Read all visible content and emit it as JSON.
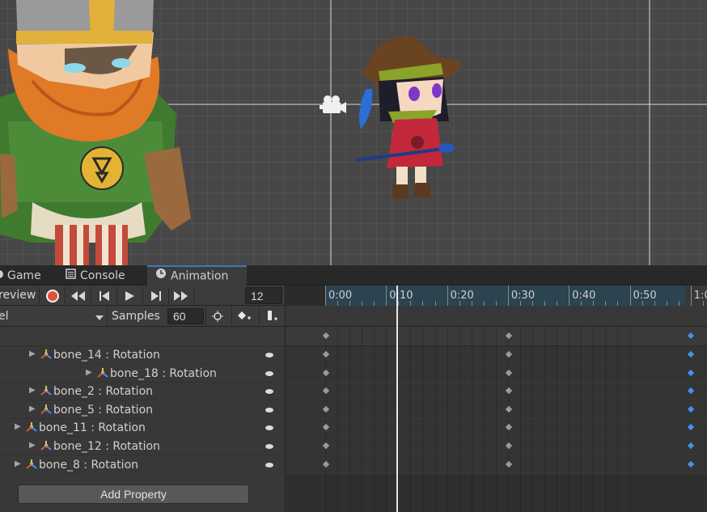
{
  "tabs": [
    {
      "label": "Game",
      "icon": "game-icon"
    },
    {
      "label": "Console",
      "icon": "console-icon"
    },
    {
      "label": "Animation",
      "icon": "clock-icon"
    }
  ],
  "toolbar": {
    "preview_label": "review",
    "frame_value": "12",
    "clip_label": "el",
    "samples_label": "Samples",
    "samples_value": "60"
  },
  "ruler": [
    "0:00",
    "0:10",
    "0:20",
    "0:30",
    "0:40",
    "0:50",
    "1:0"
  ],
  "properties": [
    {
      "label": "bone_14 : Rotation",
      "expandable": true
    },
    {
      "label": "bone_18 : Rotation",
      "expandable": true
    },
    {
      "label": "bone_2 : Rotation",
      "expandable": true
    },
    {
      "label": "bone_5 : Rotation",
      "expandable": true
    },
    {
      "label": "bone_11 : Rotation",
      "expandable": true
    },
    {
      "label": "bone_12 : Rotation",
      "expandable": true
    },
    {
      "label": "bone_8 : Rotation",
      "expandable": true
    }
  ],
  "add_property_label": "Add Property",
  "colors": {
    "accent": "#3a79bb",
    "record": "#e0503c",
    "selected_key": "#4a8fe0"
  }
}
